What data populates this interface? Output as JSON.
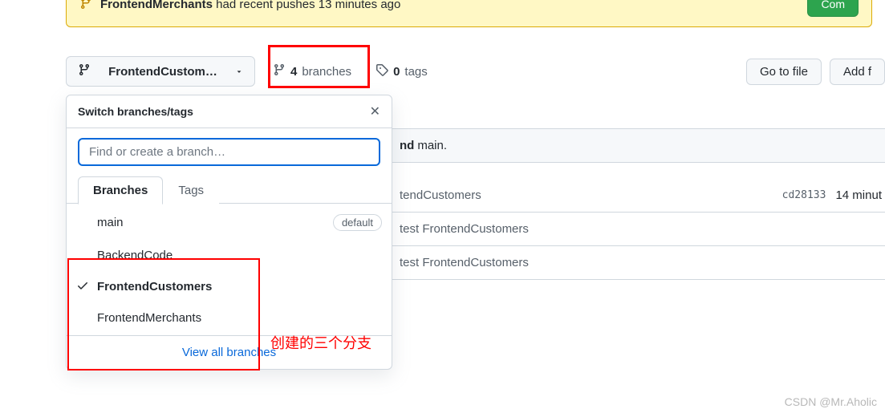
{
  "notification": {
    "branch": "FrontendMerchants",
    "msg_suffix": " had recent pushes 13 minutes ago",
    "button": "Com"
  },
  "toolbar": {
    "branch_button": "FrontendCustom…",
    "branches_count": "4",
    "branches_label": "branches",
    "tags_count": "0",
    "tags_label": "tags",
    "go_to_file": "Go to file",
    "add_file": "Add f"
  },
  "dropdown": {
    "title": "Switch branches/tags",
    "search_placeholder": "Find or create a branch…",
    "tab_branches": "Branches",
    "tab_tags": "Tags",
    "default_badge": "default",
    "items": [
      {
        "name": "main",
        "default": true,
        "selected": false
      },
      {
        "name": "BackendCode",
        "default": false,
        "selected": false
      },
      {
        "name": "FrontendCustomers",
        "default": false,
        "selected": true
      },
      {
        "name": "FrontendMerchants",
        "default": false,
        "selected": false
      }
    ],
    "view_all": "View all branches"
  },
  "annotation": "创建的三个分支",
  "content": {
    "row0_prefix": "nd",
    "row0_rest": "main.",
    "row1_text": "tendCustomers",
    "row1_hash": "cd28133",
    "row1_time": "14 minut",
    "row2_text": "test FrontendCustomers",
    "row3_text": "test FrontendCustomers"
  },
  "watermark": "CSDN @Mr.Aholic"
}
